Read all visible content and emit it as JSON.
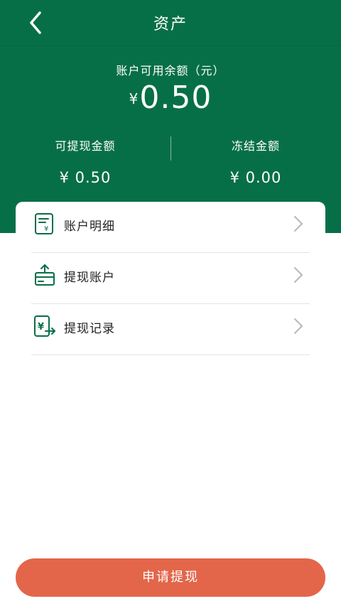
{
  "nav": {
    "title": "资产"
  },
  "balance": {
    "label": "账户可用余额（元）",
    "currency": "¥",
    "amount": "0.50"
  },
  "withdrawable": {
    "label": "可提现金额",
    "amount": "¥ 0.50"
  },
  "frozen": {
    "label": "冻结金额",
    "amount": "¥ 0.00"
  },
  "menu": {
    "items": [
      {
        "label": "账户明细",
        "icon": "statement-icon"
      },
      {
        "label": "提现账户",
        "icon": "withdraw-account-icon"
      },
      {
        "label": "提现记录",
        "icon": "withdraw-record-icon"
      }
    ]
  },
  "apply_button": {
    "label": "申请提现"
  },
  "colors": {
    "primary_green": "#076f48",
    "accent_orange": "#e3664a",
    "chevron_gray": "#bbbbbb"
  }
}
